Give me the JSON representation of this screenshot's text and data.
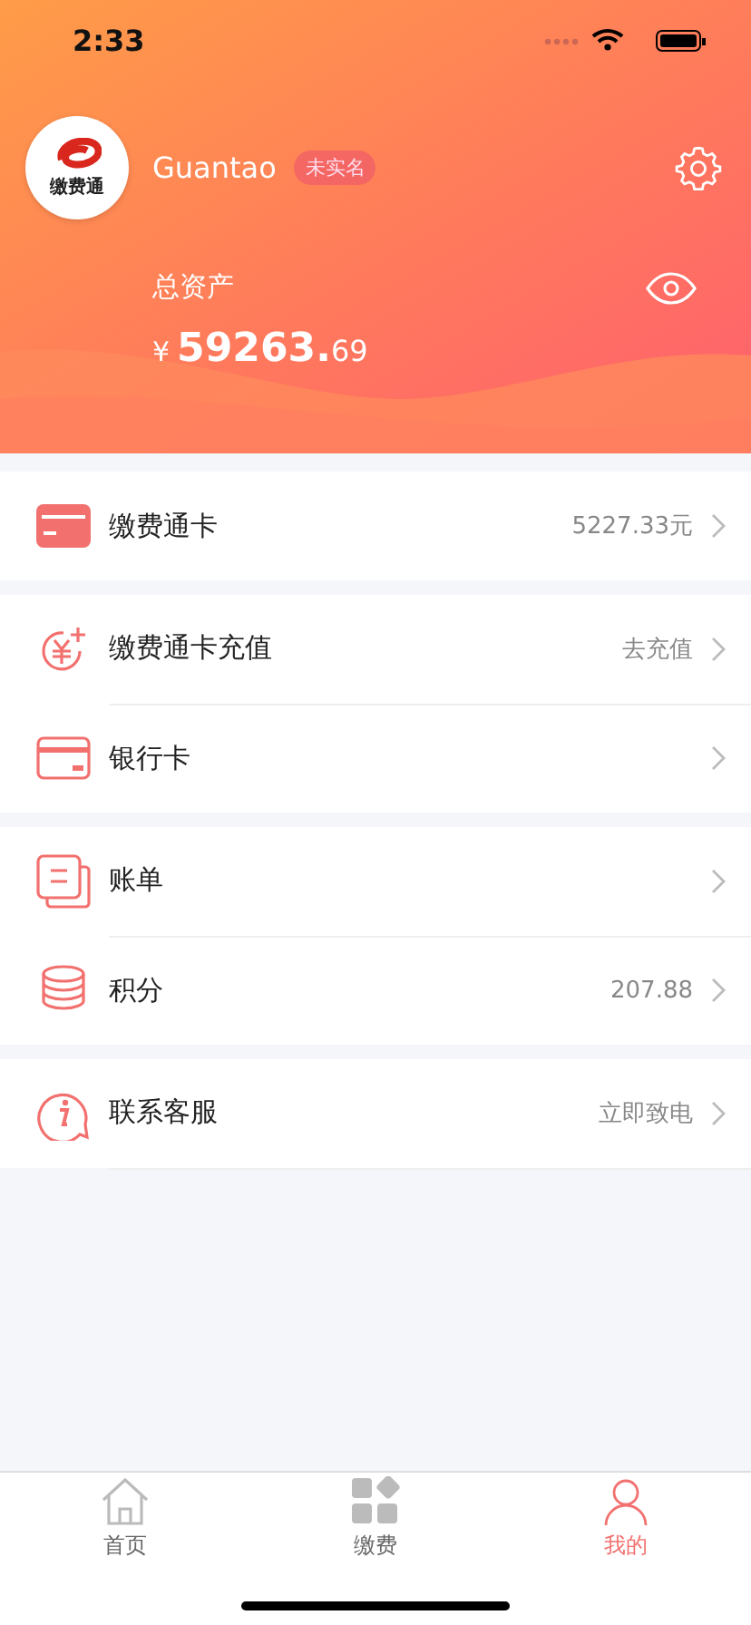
{
  "status_bar": {
    "time": "2:33"
  },
  "profile": {
    "logo_text": "缴费通",
    "name": "Guantao",
    "badge": "未实名"
  },
  "assets": {
    "label": "总资产",
    "currency": "¥",
    "integer": "59263.",
    "decimal": "69"
  },
  "groups": [
    [
      {
        "kind": "card",
        "label": "缴费通卡",
        "value": "5227.33元"
      }
    ],
    [
      {
        "kind": "recharge",
        "label": "缴费通卡充值",
        "value": "去充值"
      },
      {
        "kind": "bank",
        "label": "银行卡"
      }
    ],
    [
      {
        "kind": "bill",
        "label": "账单"
      },
      {
        "kind": "points",
        "label": "积分",
        "value": "207.88"
      }
    ],
    [
      {
        "kind": "service",
        "label": "联系客服",
        "value": "立即致电"
      }
    ]
  ],
  "tabs": [
    {
      "kind": "home",
      "label": "首页",
      "selected": false
    },
    {
      "kind": "grid",
      "label": "缴费",
      "selected": false
    },
    {
      "kind": "user",
      "label": "我的",
      "selected": true
    }
  ]
}
